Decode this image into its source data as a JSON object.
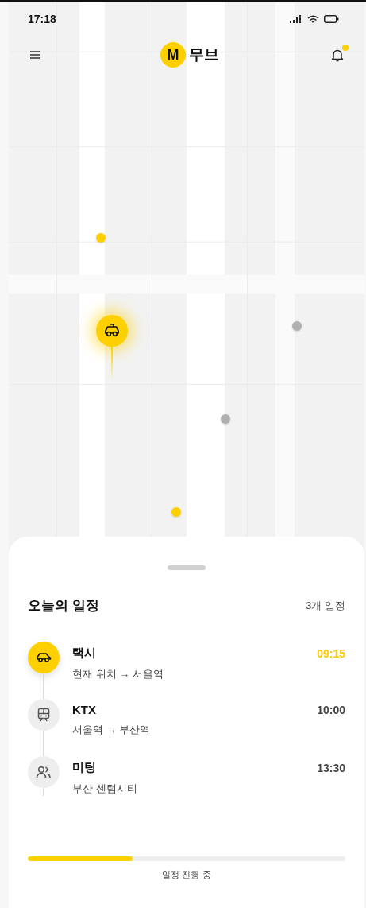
{
  "status_bar": {
    "time": "17:18"
  },
  "header": {
    "logo_letter": "M",
    "app_name": "무브",
    "has_notification": true
  },
  "map": {
    "pins": [
      {
        "kind": "dot",
        "color": "#ffd000"
      },
      {
        "kind": "vehicle",
        "color": "#ffd000"
      },
      {
        "kind": "dot",
        "color": "#b0b0b0"
      },
      {
        "kind": "dot",
        "color": "#b0b0b0"
      },
      {
        "kind": "dot",
        "color": "#ffd000"
      }
    ]
  },
  "schedule": {
    "title": "오늘의 일정",
    "count": "3개 일정",
    "items": [
      {
        "kind": "taxi",
        "title": "택시",
        "route": "현재 위치 → 서울역",
        "time": "09:15",
        "current": true
      },
      {
        "kind": "train",
        "title": "KTX",
        "route": "서울역 → 부산역",
        "time": "10:00",
        "current": false
      },
      {
        "kind": "meeting",
        "title": "미팅",
        "route": "부산 센텀시티",
        "time": "13:30",
        "current": false
      }
    ],
    "progress": {
      "level": 0.33,
      "label": "일정 진행 중"
    }
  }
}
